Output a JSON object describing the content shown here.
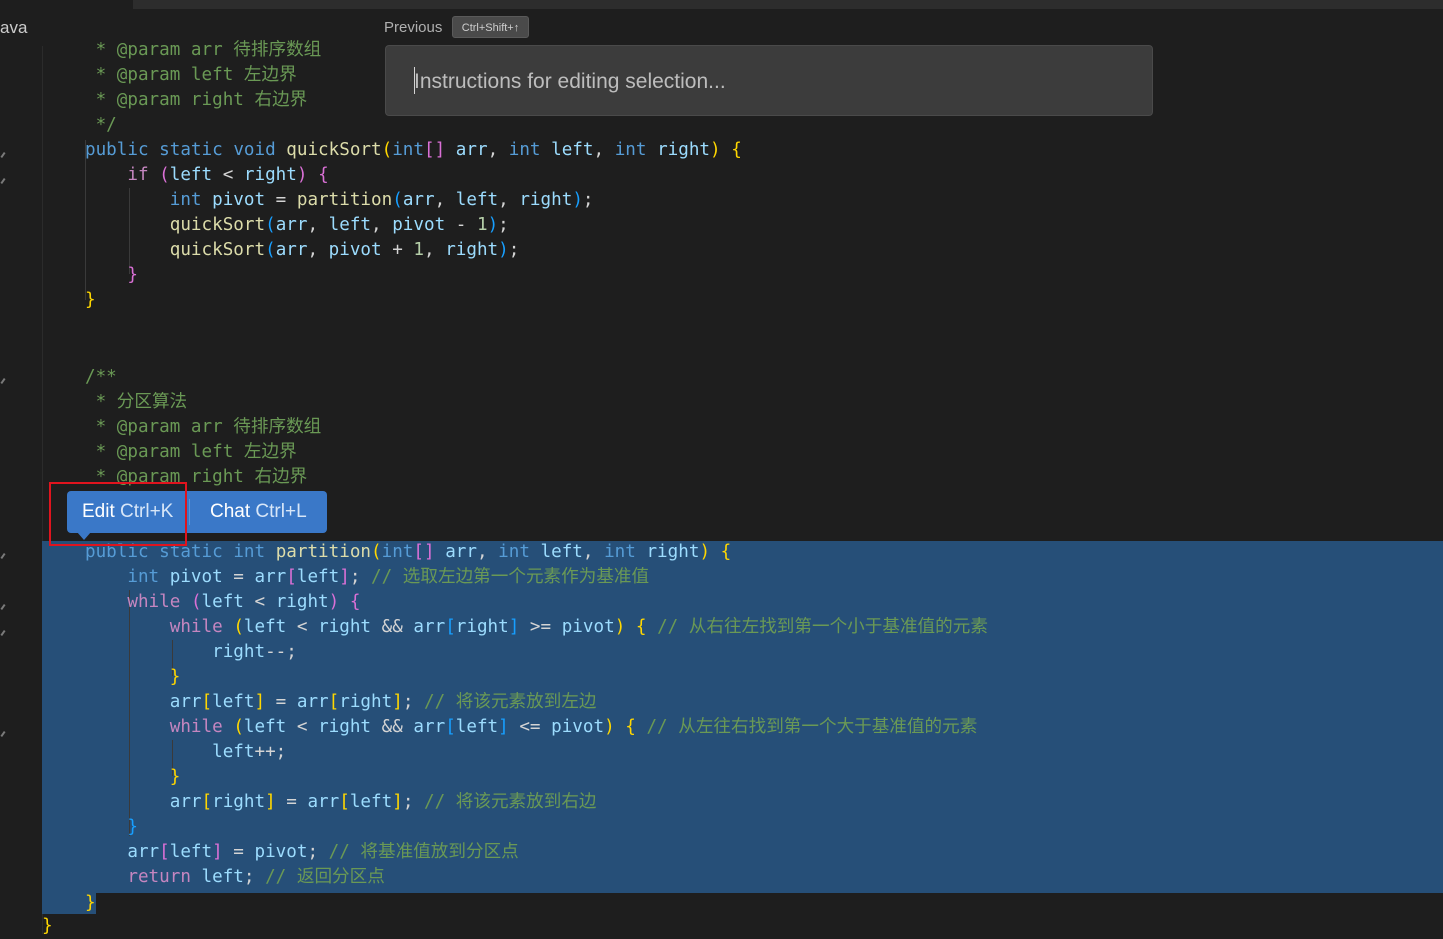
{
  "header": {
    "file_tab_fragment": "ava",
    "previous_label": "Previous",
    "previous_shortcut": "Ctrl+Shift+↑"
  },
  "edit_prompt": {
    "placeholder": "Instructions for editing selection..."
  },
  "selection_popup": {
    "edit_label": "Edit",
    "edit_shortcut": "Ctrl+K",
    "chat_label": "Chat",
    "chat_shortcut": "Ctrl+L"
  },
  "code": {
    "line_0": " * @param arr 待排序数组",
    "line_1": " * @param left 左边界",
    "line_2": " * @param right 右边界",
    "line_3": " */",
    "line_4": "public static void quickSort(int[] arr, int left, int right) {",
    "line_5": "    if (left < right) {",
    "line_6": "        int pivot = partition(arr, left, right);",
    "line_7": "        quickSort(arr, left, pivot - 1);",
    "line_8": "        quickSort(arr, pivot + 1, right);",
    "line_9": "    }",
    "line_10": "}",
    "line_11": "/**",
    "line_12": " * 分区算法",
    "line_13": " * @param arr 待排序数组",
    "line_14": " * @param left 左边界",
    "line_15": " * @param right 右边界",
    "line_16": "public static int partition(int[] arr, int left, int right) {",
    "line_17": "    int pivot = arr[left]; // 选取左边第一个元素作为基准值",
    "line_18": "    while (left < right) {",
    "line_19": "        while (left < right && arr[right] >= pivot) { // 从右往左找到第一个小于基准值的元素",
    "line_20": "            right--;",
    "line_21": "        }",
    "line_22": "        arr[left] = arr[right]; // 将该元素放到左边",
    "line_23": "        while (left < right && arr[left] <= pivot) { // 从左往右找到第一个大于基准值的元素",
    "line_24": "            left++;",
    "line_25": "        }",
    "line_26": "        arr[right] = arr[left]; // 将该元素放到右边",
    "line_27": "    }",
    "line_28": "    arr[left] = pivot; // 将基准值放到分区点",
    "line_29": "    return left; // 返回分区点",
    "line_30": "}",
    "line_31": "}"
  }
}
